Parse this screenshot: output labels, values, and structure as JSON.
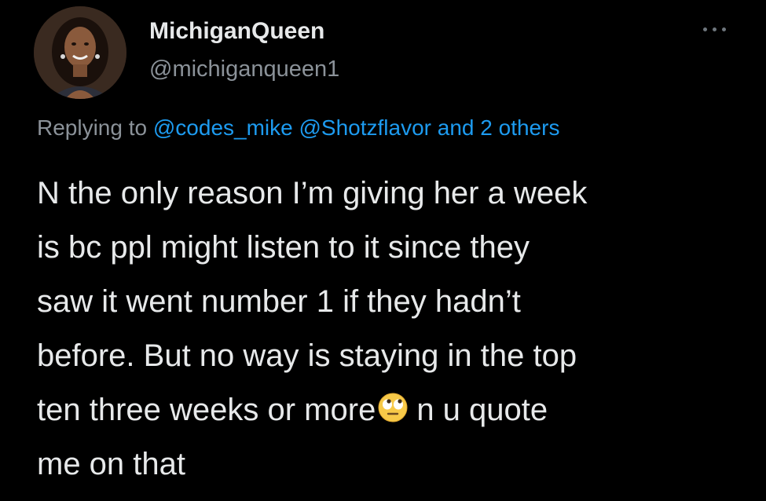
{
  "author": {
    "display_name": "MichiganQueen",
    "handle": "@michiganqueen1"
  },
  "more_icon": "more-horizontal-icon",
  "reply": {
    "prefix": "Replying to",
    "mention_1": "@codes_mike",
    "mention_2": "@Shotzflavor",
    "suffix": "and 2 others"
  },
  "tweet": {
    "line_1": "N the only reason I’m giving her a week",
    "line_2": "is bc ppl might listen to it since they",
    "line_3": "saw it went number 1 if they hadn’t",
    "line_4": "before. But no way is staying in the top",
    "line_5_start": "ten three weeks or more",
    "line_5_end": "n u quote",
    "line_6": "me on that",
    "emoji": "face-with-rolling-eyes-emoji"
  },
  "colors": {
    "background": "#000000",
    "text_primary": "#e7e9ea",
    "text_secondary": "#8b9299",
    "link": "#1d9bf0"
  }
}
